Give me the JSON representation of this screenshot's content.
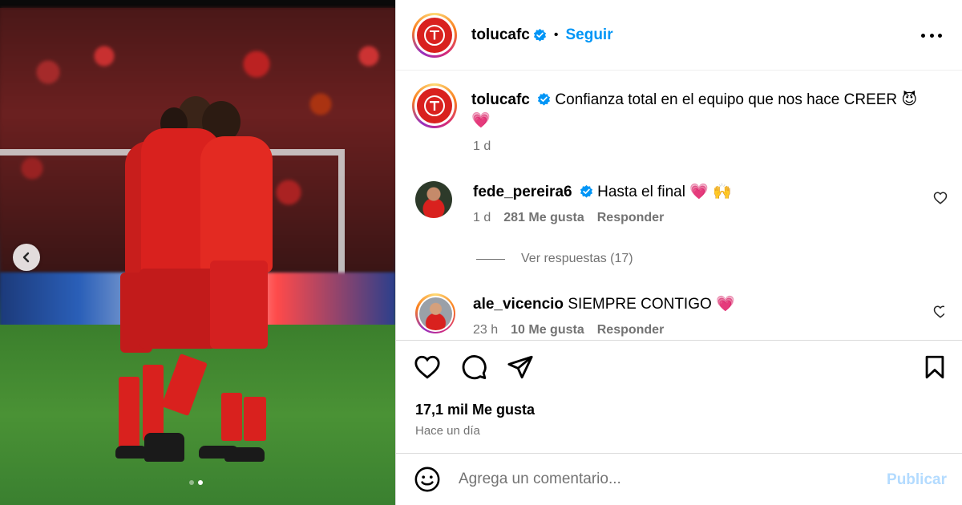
{
  "post": {
    "slide_count": 2,
    "active_slide": 2
  },
  "header": {
    "username": "tolucafc",
    "separator": "•",
    "follow_label": "Seguir"
  },
  "caption": {
    "username": "tolucafc",
    "text": "Confianza total en el equipo que nos hace CREER",
    "emoji_devil": "😈",
    "emoji_heart": "💗",
    "time": "1 d"
  },
  "comments": [
    {
      "username": "fede_pereira6",
      "text": "Hasta el final",
      "emojis": "💗 🙌",
      "time": "1 d",
      "likes": "281 Me gusta",
      "reply_label": "Responder"
    },
    {
      "username": "ale_vicencio",
      "text": "SIEMPRE CONTIGO",
      "emojis": "💗",
      "time": "23 h",
      "likes": "10 Me gusta",
      "reply_label": "Responder"
    }
  ],
  "view_replies_label": "Ver respuestas (17)",
  "engagement": {
    "likes": "17,1 mil Me gusta",
    "posted": "Hace un día"
  },
  "comment_box": {
    "placeholder": "Agrega un comentario...",
    "publish_label": "Publicar"
  },
  "icons": {
    "prev": "chevron-left-icon",
    "more": "more-horizontal-icon",
    "verified": "verified-badge-icon",
    "like": "heart-icon",
    "comment": "comment-bubble-icon",
    "share": "paper-plane-icon",
    "save": "bookmark-icon",
    "emoji": "emoji-smile-icon"
  },
  "colors": {
    "accent_blue": "#0095f6",
    "verified_blue": "#0095f6",
    "muted_text": "#737373",
    "publish_disabled": "#b3dbff",
    "brand_red": "#d9211e"
  }
}
